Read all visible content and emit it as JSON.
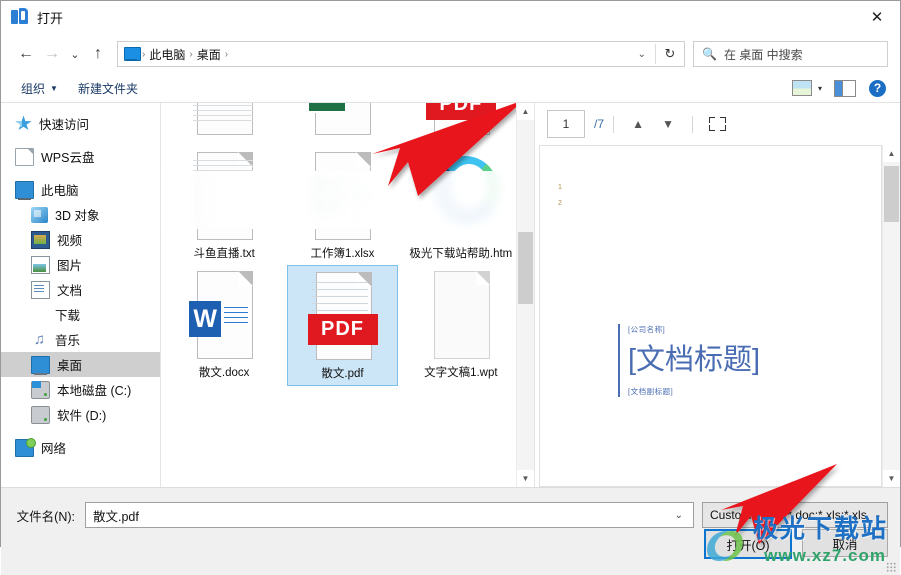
{
  "window": {
    "title": "打开",
    "app_icon": "wps-icon",
    "close_label": "✕"
  },
  "nav": {
    "back": "←",
    "forward": "→",
    "recent": "⌄",
    "up": "↑",
    "breadcrumbs": [
      "此电脑",
      "桌面"
    ],
    "address_caret": "⌄",
    "refresh": "↻",
    "search_placeholder": "在 桌面 中搜索",
    "search_icon": "search-icon"
  },
  "toolbar": {
    "organize": "组织",
    "new_folder": "新建文件夹",
    "view_caret": "▾",
    "help": "?"
  },
  "sidebar": {
    "items": [
      {
        "label": "快速访问",
        "icon": "star-icon",
        "indent": false,
        "selected": false
      },
      {
        "label": "WPS云盘",
        "icon": "doc-icon",
        "indent": false,
        "selected": false
      },
      {
        "label": "此电脑",
        "icon": "pc-icon",
        "indent": false,
        "selected": false
      },
      {
        "label": "3D 对象",
        "icon": "cube-icon",
        "indent": true,
        "selected": false
      },
      {
        "label": "视频",
        "icon": "video-icon",
        "indent": true,
        "selected": false
      },
      {
        "label": "图片",
        "icon": "picture-icon",
        "indent": true,
        "selected": false
      },
      {
        "label": "文档",
        "icon": "documents-icon",
        "indent": true,
        "selected": false
      },
      {
        "label": "下载",
        "icon": "download-icon",
        "indent": true,
        "selected": false
      },
      {
        "label": "音乐",
        "icon": "music-icon",
        "indent": true,
        "selected": false
      },
      {
        "label": "桌面",
        "icon": "desktop-icon",
        "indent": true,
        "selected": true
      },
      {
        "label": "本地磁盘 (C:)",
        "icon": "drive-c-icon",
        "indent": true,
        "selected": false
      },
      {
        "label": "软件 (D:)",
        "icon": "drive-d-icon",
        "indent": true,
        "selected": false
      },
      {
        "label": "网络",
        "icon": "network-icon",
        "indent": false,
        "selected": false
      }
    ]
  },
  "files": {
    "row1": [
      {
        "name": "",
        "icon": "text-file-icon",
        "selected": false
      },
      {
        "name": "",
        "icon": "excel-file-icon",
        "selected": false
      },
      {
        "name": "",
        "icon": "pdf-file-icon",
        "selected": false
      }
    ],
    "row2": [
      {
        "name": "斗鱼直播.txt",
        "icon": "text-file-icon",
        "selected": false
      },
      {
        "name": "工作簿1.xlsx",
        "icon": "excel-file-icon",
        "selected": false
      },
      {
        "name": "极光下载站帮助.htm",
        "icon": "edge-file-icon",
        "selected": false
      }
    ],
    "row3": [
      {
        "name": "散文.docx",
        "icon": "word-file-icon",
        "selected": false
      },
      {
        "name": "散文.pdf",
        "icon": "pdf-file-icon",
        "selected": true
      },
      {
        "name": "文字文稿1.wpt",
        "icon": "wps-template-icon",
        "selected": false
      }
    ]
  },
  "preview": {
    "current_page": "1",
    "total_pages": "/7",
    "prev_icon": "chevron-up-icon",
    "next_icon": "chevron-down-icon",
    "fit_icon": "fit-page-icon",
    "line_numbers": [
      "1",
      "2"
    ],
    "company": "[公司名称]",
    "title": "[文档标题]",
    "subtitle": "[文档副标题]"
  },
  "bottom": {
    "filename_label": "文件名(N):",
    "filename_value": "散文.pdf",
    "filename_caret": "⌄",
    "filter_value": "Custom Files (*.doc;*.xls;*.xls",
    "filter_caret": "⌄",
    "open_button": "打开(O)",
    "cancel_button": "取消"
  },
  "watermark": {
    "brand": "极光下载站",
    "url": "www.xz7.com"
  },
  "colors": {
    "accent": "#0a74d0",
    "pdf_red": "#e0181f",
    "word_blue": "#1d5fb0",
    "excel_green": "#1e7145",
    "selection": "#cce5f7",
    "arrow_red": "#e8191f"
  }
}
